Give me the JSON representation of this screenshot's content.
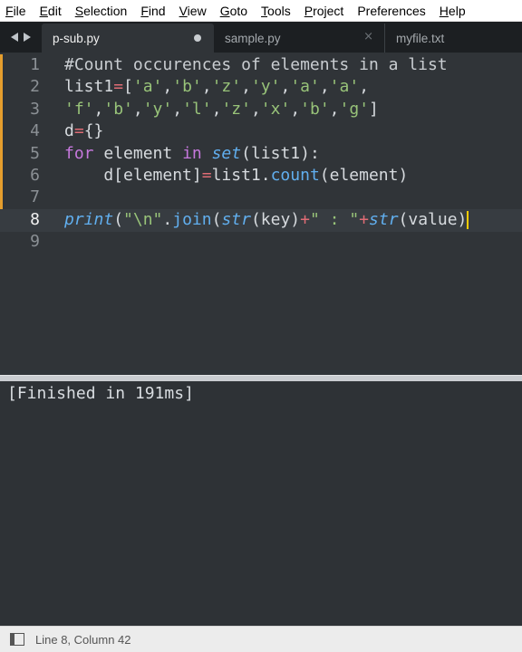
{
  "menu": [
    {
      "mnemonic": "F",
      "rest": "ile"
    },
    {
      "mnemonic": "E",
      "rest": "dit"
    },
    {
      "mnemonic": "S",
      "rest": "election"
    },
    {
      "mnemonic": "F",
      "rest": "ind"
    },
    {
      "mnemonic": "V",
      "rest": "iew"
    },
    {
      "mnemonic": "G",
      "rest": "oto"
    },
    {
      "mnemonic": "T",
      "rest": "ools"
    },
    {
      "mnemonic": "P",
      "rest": "roject"
    },
    {
      "mnemonic": "",
      "rest": "Preferences"
    },
    {
      "mnemonic": "H",
      "rest": "elp"
    }
  ],
  "tabs": [
    {
      "label": "p-sub.py",
      "active": true,
      "dirty": true
    },
    {
      "label": "sample.py",
      "active": false,
      "close_icon": "×"
    },
    {
      "label": "myfile.txt",
      "active": false
    }
  ],
  "editor": {
    "line_numbers": [
      "1",
      "2",
      "3",
      "4",
      "5",
      "6",
      "7",
      "8",
      "9"
    ],
    "current_line": 8,
    "lines": [
      [
        {
          "t": "#Count occurences of elements in a list",
          "c": "comment"
        }
      ],
      [
        {
          "t": "list1",
          "c": "pl"
        },
        {
          "t": "=",
          "c": "op"
        },
        {
          "t": "[",
          "c": "pl"
        },
        {
          "t": "'a'",
          "c": "str"
        },
        {
          "t": ",",
          "c": "pl"
        },
        {
          "t": "'b'",
          "c": "str"
        },
        {
          "t": ",",
          "c": "pl"
        },
        {
          "t": "'z'",
          "c": "str"
        },
        {
          "t": ",",
          "c": "pl"
        },
        {
          "t": "'y'",
          "c": "str"
        },
        {
          "t": ",",
          "c": "pl"
        },
        {
          "t": "'a'",
          "c": "str"
        },
        {
          "t": ",",
          "c": "pl"
        },
        {
          "t": "'a'",
          "c": "str"
        },
        {
          "t": ",",
          "c": "pl"
        }
      ],
      [
        {
          "t": "'f'",
          "c": "str"
        },
        {
          "t": ",",
          "c": "pl"
        },
        {
          "t": "'b'",
          "c": "str"
        },
        {
          "t": ",",
          "c": "pl"
        },
        {
          "t": "'y'",
          "c": "str"
        },
        {
          "t": ",",
          "c": "pl"
        },
        {
          "t": "'l'",
          "c": "str"
        },
        {
          "t": ",",
          "c": "pl"
        },
        {
          "t": "'z'",
          "c": "str"
        },
        {
          "t": ",",
          "c": "pl"
        },
        {
          "t": "'x'",
          "c": "str"
        },
        {
          "t": ",",
          "c": "pl"
        },
        {
          "t": "'b'",
          "c": "str"
        },
        {
          "t": ",",
          "c": "pl"
        },
        {
          "t": "'g'",
          "c": "str"
        },
        {
          "t": "]",
          "c": "pl"
        }
      ],
      [
        {
          "t": "d",
          "c": "pl"
        },
        {
          "t": "=",
          "c": "op"
        },
        {
          "t": "{}",
          "c": "pl"
        }
      ],
      [
        {
          "t": "for",
          "c": "kw"
        },
        {
          "t": " element ",
          "c": "pl"
        },
        {
          "t": "in",
          "c": "kw"
        },
        {
          "t": " ",
          "c": "pl"
        },
        {
          "t": "set",
          "c": "bi"
        },
        {
          "t": "(list1):",
          "c": "pl"
        }
      ],
      [
        {
          "t": "    d[element]",
          "c": "pl"
        },
        {
          "t": "=",
          "c": "op"
        },
        {
          "t": "list1.",
          "c": "pl"
        },
        {
          "t": "count",
          "c": "fn"
        },
        {
          "t": "(element)",
          "c": "pl"
        }
      ],
      [],
      [
        {
          "t": "print",
          "c": "bi"
        },
        {
          "t": "(",
          "c": "pl"
        },
        {
          "t": "\"\\n\"",
          "c": "str"
        },
        {
          "t": ".",
          "c": "pl"
        },
        {
          "t": "join",
          "c": "fn"
        },
        {
          "t": "(",
          "c": "pl"
        },
        {
          "t": "str",
          "c": "bi"
        },
        {
          "t": "(key)",
          "c": "pl"
        },
        {
          "t": "+",
          "c": "op"
        },
        {
          "t": "\" : \"",
          "c": "str"
        },
        {
          "t": "+",
          "c": "op"
        },
        {
          "t": "str",
          "c": "bi"
        },
        {
          "t": "(value)",
          "c": "pl"
        }
      ],
      []
    ]
  },
  "output": {
    "text": "[Finished in 191ms]"
  },
  "status": {
    "position": "Line 8, Column 42"
  },
  "colors": {
    "accent": "#e59e2d",
    "background": "#303438",
    "caret": "#ffcc00"
  }
}
